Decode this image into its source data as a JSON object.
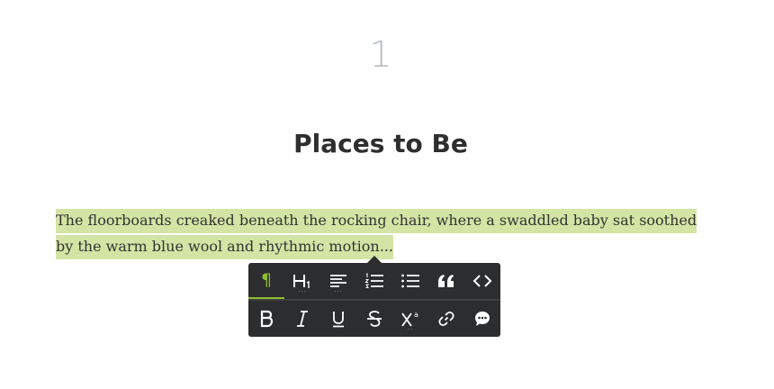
{
  "page": {
    "number": "1",
    "title": "Places to Be",
    "paragraph": "The floorboards creaked beneath the rocking chair, where a swaddled baby sat soothed by the warm blue wool and rhythmic motion..."
  },
  "toolbar": {
    "row1": [
      {
        "name": "paragraph-icon",
        "active": true
      },
      {
        "name": "heading-icon",
        "dropdown": true
      },
      {
        "name": "align-left-icon",
        "dropdown": true
      },
      {
        "name": "ordered-list-icon"
      },
      {
        "name": "unordered-list-icon"
      },
      {
        "name": "quote-icon"
      },
      {
        "name": "code-icon"
      }
    ],
    "row2": [
      {
        "name": "bold-icon"
      },
      {
        "name": "italic-icon"
      },
      {
        "name": "underline-icon"
      },
      {
        "name": "strikethrough-icon"
      },
      {
        "name": "superscript-icon",
        "dropdown": true
      },
      {
        "name": "link-icon"
      },
      {
        "name": "comment-icon"
      }
    ],
    "colors": {
      "background": "#2c2d2e",
      "accent": "#8dbd2c",
      "icon": "#ffffff"
    }
  },
  "colors": {
    "highlight": "#d3e4a4",
    "title": "#2e2e2e",
    "page_number": "#b8bcc0"
  }
}
